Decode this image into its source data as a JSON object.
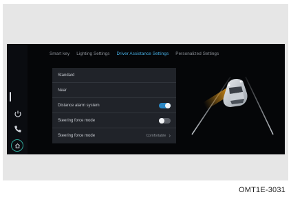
{
  "tabs": [
    {
      "label": "Smart key",
      "active": false
    },
    {
      "label": "Lighting Settings",
      "active": false
    },
    {
      "label": "Driver Assistance Settings",
      "active": true
    },
    {
      "label": "Personalized Settings",
      "active": false
    }
  ],
  "settings": [
    {
      "label": "Standard"
    },
    {
      "label": "Near"
    },
    {
      "label": "Distance alarm system",
      "toggle": "on"
    },
    {
      "label": "Steering force mode",
      "toggle": "off"
    },
    {
      "label": "Steering force mode",
      "value": "Comfortable"
    }
  ],
  "sidebar_icons": [
    "voice-icon",
    "phone-icon",
    "home-icon"
  ],
  "figure_code": "OMT1E-3031",
  "colors": {
    "accent": "#47b0e6",
    "toggle_on": "#2a86c2",
    "home_ring": "#2fa89a",
    "warning_beam": "#f2a21b"
  }
}
